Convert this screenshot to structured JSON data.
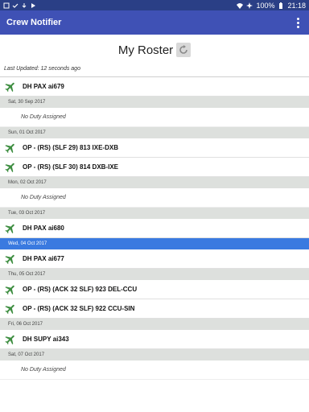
{
  "status": {
    "battery": "100%",
    "time": "21:18"
  },
  "app": {
    "title": "Crew Notifier"
  },
  "header": {
    "title": "My Roster",
    "last_updated": "Last Updated: 12 seconds ago"
  },
  "rows": [
    {
      "kind": "duty",
      "text": "DH PAX ai679"
    },
    {
      "kind": "date",
      "text": "Sat, 30 Sep 2017"
    },
    {
      "kind": "none",
      "text": "No Duty Assigned"
    },
    {
      "kind": "date",
      "text": "Sun, 01 Oct 2017"
    },
    {
      "kind": "duty",
      "text": "OP - (RS) (SLF 29) 813 IXE-DXB"
    },
    {
      "kind": "duty",
      "text": "OP - (RS) (SLF 30) 814 DXB-IXE"
    },
    {
      "kind": "date",
      "text": "Mon, 02 Oct 2017"
    },
    {
      "kind": "none",
      "text": "No Duty Assigned"
    },
    {
      "kind": "date",
      "text": "Tue, 03 Oct 2017"
    },
    {
      "kind": "duty",
      "text": "DH PAX ai680"
    },
    {
      "kind": "date",
      "text": "Wed, 04 Oct 2017",
      "selected": true
    },
    {
      "kind": "duty",
      "text": "DH PAX ai677"
    },
    {
      "kind": "date",
      "text": "Thu, 05 Oct 2017"
    },
    {
      "kind": "duty",
      "text": "OP - (RS) (ACK 32 SLF) 923 DEL-CCU"
    },
    {
      "kind": "duty",
      "text": "OP - (RS) (ACK 32 SLF) 922 CCU-SIN"
    },
    {
      "kind": "date",
      "text": "Fri, 06 Oct 2017"
    },
    {
      "kind": "duty",
      "text": "DH SUPY ai343"
    },
    {
      "kind": "date",
      "text": "Sat, 07 Oct 2017"
    },
    {
      "kind": "none",
      "text": "No Duty Assigned"
    }
  ],
  "icons": {
    "duty": "airplane-icon",
    "refresh": "refresh-icon",
    "menu": "more-vert-icon"
  },
  "colors": {
    "appbar": "#3f51b5",
    "statusbar": "#2a3f86",
    "plane": "#3e8e41",
    "selected": "#3a7ae0"
  }
}
